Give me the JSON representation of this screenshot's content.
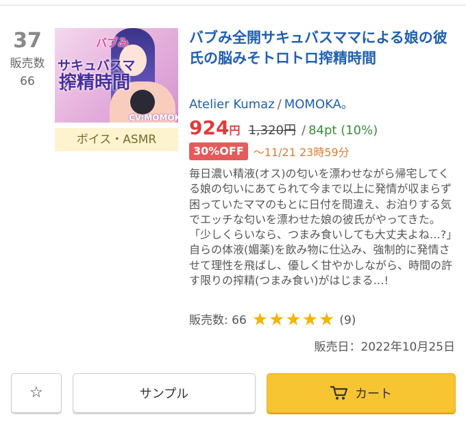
{
  "rank": {
    "number": "37",
    "sales_label": "販売数",
    "sales_count": "66"
  },
  "product": {
    "thumbnail_text": {
      "main_title": "サキュバスママ",
      "sub_title": "搾精時間",
      "corner_text": "バブみ",
      "credit": "CV:MOMOKA。"
    },
    "genre": "ボイス・ASMR",
    "title": "バブみ全開サキュバスママによる娘の彼氏の脳みそトロトロ搾精時間",
    "circle": "Atelier Kumaz",
    "separator": "/",
    "voice_actor": "MOMOKA。",
    "price": "924",
    "price_unit": "円",
    "original_price": "1,320円",
    "points": "84pt (10%)",
    "discount_badge": "30%OFF",
    "sale_until": "〜11/21 23時59分",
    "description": "毎日濃い精液(オス)の匂いを漂わせながら帰宅してくる娘の匂いにあてられて今まで以上に発情が収まらず困っていたママのもとに日付を間違え、お泊りする気でエッチな匂いを漂わせた娘の彼氏がやってきた。「少しくらいなら、つまみ食いしても大丈夫よね…?」自らの体液(媚薬)を飲み物に仕込み、強制的に発情させて理性を飛ばし、優しく甘やかしながら、時間の許す限りの搾精(つまみ食い)がはじまる…!",
    "sales_stat": "販売数: 66",
    "rating_stars": 5,
    "stars_display": "★★★★★",
    "review_count": "(9)",
    "release_date": "販売日：2022年10月25日"
  },
  "actions": {
    "favorite_icon": "star-outline-icon",
    "sample_label": "サンプル",
    "cart_icon": "cart-icon",
    "cart_label": "カート"
  },
  "colors": {
    "title_blue": "#1f5fb0",
    "price_red": "#e03a3a",
    "points_green": "#3a8c3a",
    "sale_orange": "#e07a2a",
    "star_yellow": "#f5b400",
    "cart_yellow": "#f7c531"
  }
}
